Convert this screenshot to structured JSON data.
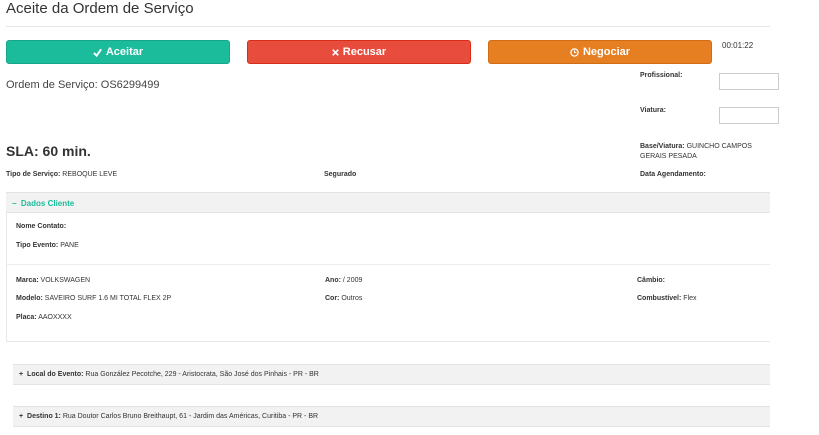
{
  "page": {
    "title": "Aceite da Ordem de Serviço",
    "timer": "00:01:22"
  },
  "actions": {
    "accept_label": "Aceitar",
    "refuse_label": "Recusar",
    "negotiate_label": "Negociar",
    "accept_icon": "check-icon",
    "refuse_icon": "x-icon",
    "negotiate_icon": "clock-icon",
    "colors": {
      "accept": "#1abc9c",
      "refuse": "#e74c3c",
      "negotiate": "#e67e22"
    }
  },
  "order": {
    "label": "Ordem de Serviço: OS6299499",
    "sla": "SLA: 60 min.",
    "professional_label": "Profissional:",
    "professional_value": "",
    "vehicle_label": "Viatura:",
    "vehicle_value": "",
    "base_label": "Base/Viatura:",
    "base_value": "GUINCHO CAMPOS GERAIS PESADA",
    "service_type_label": "Tipo de Serviço:",
    "service_type_value": "REBOQUE LEVE",
    "insured_label": "Segurado",
    "schedule_label": "Data Agendamento:"
  },
  "client": {
    "toggle": "−",
    "section_title": "Dados Cliente",
    "contact_label": "Nome Contato:",
    "event_label": "Tipo Evento:",
    "event_value": "PANE",
    "brand_label": "Marca:",
    "brand_value": "VOLKSWAGEN",
    "year_label": "Ano:",
    "year_value": "/ 2009",
    "gear_label": "Câmbio:",
    "model_label": "Modelo:",
    "model_value": "SAVEIRO SURF 1.6 MI TOTAL FLEX 2P",
    "color_label": "Cor:",
    "color_value": "Outros",
    "fuel_label": "Combustível:",
    "fuel_value": "Flex",
    "plate_label": "Placa:",
    "plate_value": "AAOXXXX"
  },
  "locations": {
    "toggle": "+",
    "event_label": "Local do Evento:",
    "event_value": "Rua González Pecotche, 229 - Aristocrata, São José dos Pinhais - PR - BR",
    "dest_label": "Destino 1:",
    "dest_value": "Rua Doutor Carlos Bruno Breithaupt, 61 - Jardim das Américas, Curitiba - PR - BR"
  }
}
